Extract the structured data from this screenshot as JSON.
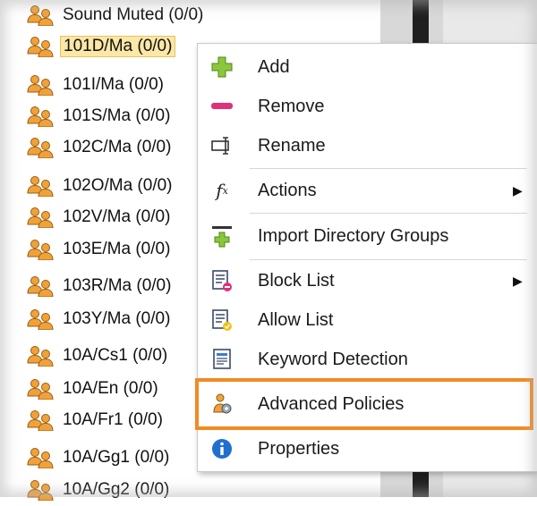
{
  "tree": {
    "items": [
      {
        "label": "Sound Muted (0/0)"
      },
      {
        "label": "101D/Ma (0/0)"
      },
      {
        "label": "101I/Ma (0/0)"
      },
      {
        "label": "101S/Ma (0/0)"
      },
      {
        "label": "102C/Ma (0/0)"
      },
      {
        "label": "102O/Ma (0/0)"
      },
      {
        "label": "102V/Ma (0/0)"
      },
      {
        "label": "103E/Ma (0/0)"
      },
      {
        "label": "103R/Ma (0/0)"
      },
      {
        "label": "103Y/Ma (0/0)"
      },
      {
        "label": "10A/Cs1 (0/0)"
      },
      {
        "label": "10A/En (0/0)"
      },
      {
        "label": "10A/Fr1 (0/0)"
      },
      {
        "label": "10A/Gg1 (0/0)"
      },
      {
        "label": "10A/Gg2 (0/0)"
      }
    ]
  },
  "menu": {
    "items": [
      {
        "label": "Add",
        "icon": "plus-icon"
      },
      {
        "label": "Remove",
        "icon": "minus-icon"
      },
      {
        "label": "Rename",
        "icon": "rename-icon"
      },
      {
        "label": "Actions",
        "icon": "function-icon",
        "submenu": "▶"
      },
      {
        "label": "Import Directory Groups",
        "icon": "import-icon"
      },
      {
        "label": "Block List",
        "icon": "block-list-icon",
        "submenu": "▶"
      },
      {
        "label": "Allow List",
        "icon": "allow-list-icon"
      },
      {
        "label": "Keyword Detection",
        "icon": "keyword-icon"
      },
      {
        "label": "Advanced Policies",
        "icon": "advanced-policies-icon"
      },
      {
        "label": "Properties",
        "icon": "info-icon"
      }
    ],
    "highlight_color": "#f28a24"
  }
}
